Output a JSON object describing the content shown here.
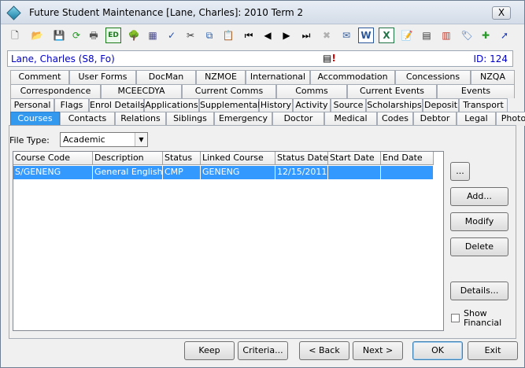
{
  "window": {
    "title": "Future Student Maintenance  [Lane, Charles]: 2010 Term 2",
    "close_label": "X"
  },
  "toolbar": {
    "icons": [
      {
        "name": "new-record-icon",
        "glyph": "🗋",
        "color": "#333333",
        "dim": false
      },
      {
        "name": "open-folder-icon",
        "glyph": "📂",
        "color": "#d9a520",
        "dim": false
      },
      {
        "name": "save-icon",
        "glyph": "💾",
        "color": "#999999",
        "dim": true
      },
      {
        "name": "refresh-icon",
        "glyph": "⟳",
        "color": "#1c9a1c",
        "dim": false
      },
      {
        "name": "print-icon",
        "glyph": "🖶",
        "color": "#555555",
        "dim": false
      },
      {
        "name": "edit-mode-icon",
        "glyph": "ED",
        "color": "#1c7a1c",
        "dim": false
      },
      {
        "name": "tree-icon",
        "glyph": "🌳",
        "color": "#2a8a2a",
        "dim": false
      },
      {
        "name": "calculator-icon",
        "glyph": "▦",
        "color": "#4b4b8a",
        "dim": false
      },
      {
        "name": "spellcheck-icon",
        "glyph": "✓",
        "color": "#1f4fbf",
        "dim": false
      },
      {
        "name": "cut-icon",
        "glyph": "✂",
        "color": "#333333",
        "dim": false
      },
      {
        "name": "copy-icon",
        "glyph": "⧉",
        "color": "#2a5fa8",
        "dim": false
      },
      {
        "name": "paste-icon",
        "glyph": "📋",
        "color": "#b27b1a",
        "dim": false
      },
      {
        "name": "first-record-icon",
        "glyph": "⏮",
        "color": "#000000",
        "dim": false
      },
      {
        "name": "previous-record-icon",
        "glyph": "◀",
        "color": "#000000",
        "dim": false
      },
      {
        "name": "next-record-icon",
        "glyph": "▶",
        "color": "#000000",
        "dim": false
      },
      {
        "name": "last-record-icon",
        "glyph": "⏭",
        "color": "#000000",
        "dim": false
      },
      {
        "name": "delete-icon",
        "glyph": "✖",
        "color": "#b0b0b0",
        "dim": true
      },
      {
        "name": "email-icon",
        "glyph": "✉",
        "color": "#3a5f9a",
        "dim": false
      },
      {
        "name": "word-icon",
        "glyph": "W",
        "color": "#2b579a",
        "dim": false
      },
      {
        "name": "excel-icon",
        "glyph": "X",
        "color": "#217346",
        "dim": false
      },
      {
        "name": "clipboard-icon",
        "glyph": "📝",
        "color": "#8a6a2a",
        "dim": false
      },
      {
        "name": "calendar-icon",
        "glyph": "▤",
        "color": "#333333",
        "dim": false
      },
      {
        "name": "attendance-icon",
        "glyph": "▥",
        "color": "#c0392b",
        "dim": false
      },
      {
        "name": "tag-icon",
        "glyph": "🏷",
        "color": "#3a6fc0",
        "dim": false
      },
      {
        "name": "add-note-icon",
        "glyph": "✚",
        "color": "#2a9a2a",
        "dim": false
      },
      {
        "name": "arrow-icon",
        "glyph": "➚",
        "color": "#1f3fbf",
        "dim": false
      }
    ]
  },
  "student": {
    "name": "Lane, Charles (S8, Fo)",
    "id": "ID: 124"
  },
  "tabs": {
    "row1": [
      "Comment",
      "User Forms",
      "DocMan",
      "NZMOE",
      "International",
      "Accommodation",
      "Concessions",
      "NZQA"
    ],
    "row2": [
      "Correspondence",
      "MCEECDYA",
      "Current Comms",
      "Comms",
      "Current Events",
      "Events"
    ],
    "row3": [
      "Personal",
      "Flags",
      "Enrol Details",
      "Applications",
      "Supplemental",
      "History",
      "Activity",
      "Source",
      "Scholarships",
      "Deposit",
      "Transport"
    ],
    "row4": [
      "Courses",
      "Contacts",
      "Relations",
      "Siblings",
      "Emergency",
      "Doctor",
      "Medical",
      "Codes",
      "Debtor",
      "Legal",
      "Photo"
    ],
    "active": "Courses"
  },
  "filter": {
    "label": "File Type:",
    "value": "Academic"
  },
  "grid": {
    "columns": [
      "Course Code",
      "Description",
      "Status",
      "Linked Course",
      "Status Date",
      "Start Date",
      "End Date"
    ],
    "rows": [
      [
        "S/GENENG",
        "General English",
        "CMP",
        "GENENG",
        "12/15/2011",
        "",
        ""
      ]
    ]
  },
  "side_buttons": {
    "more": "...",
    "add": "Add...",
    "modify": "Modify",
    "delete": "Delete",
    "details": "Details..."
  },
  "show_financial": {
    "label": "Show Financial",
    "checked": false
  },
  "bottom_buttons": {
    "keep": "Keep",
    "criteria": "Criteria...",
    "back": "< Back",
    "next": "Next >",
    "ok": "OK",
    "exit": "Exit"
  }
}
